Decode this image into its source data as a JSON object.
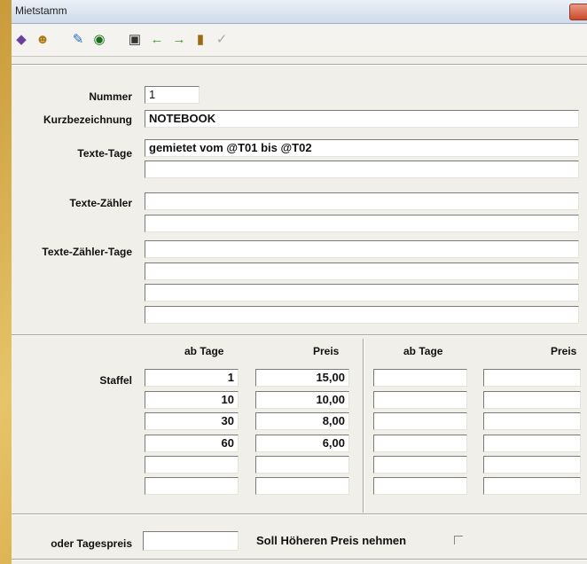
{
  "window": {
    "title": "Mietstamm"
  },
  "toolbar": {
    "icons": [
      "book-icon",
      "users-icon",
      "edit-image-icon",
      "record-icon",
      "binoculars-icon",
      "arrow-left-icon",
      "arrow-right-icon",
      "exit-door-icon",
      "checkmark-icon"
    ]
  },
  "form": {
    "nummer_label": "Nummer",
    "nummer_value": "1",
    "kurz_label": "Kurzbezeichnung",
    "kurz_value": "NOTEBOOK",
    "texte_tage_label": "Texte-Tage",
    "texte_tage_values": [
      "gemietet vom @T01 bis @T02",
      ""
    ],
    "texte_zaehler_label": "Texte-Zähler",
    "texte_zaehler_values": [
      "",
      ""
    ],
    "texte_zaehler_tage_label": "Texte-Zähler-Tage",
    "texte_zaehler_tage_values": [
      "",
      "",
      "",
      ""
    ]
  },
  "staffel": {
    "label": "Staffel",
    "col_ab_tage": "ab Tage",
    "col_preis": "Preis",
    "left_rows": [
      {
        "ab_tage": "1",
        "preis": "15,00"
      },
      {
        "ab_tage": "10",
        "preis": "10,00"
      },
      {
        "ab_tage": "30",
        "preis": "8,00"
      },
      {
        "ab_tage": "60",
        "preis": "6,00"
      },
      {
        "ab_tage": "",
        "preis": ""
      },
      {
        "ab_tage": "",
        "preis": ""
      }
    ],
    "right_rows": [
      {
        "ab_tage": "",
        "preis": ""
      },
      {
        "ab_tage": "",
        "preis": ""
      },
      {
        "ab_tage": "",
        "preis": ""
      },
      {
        "ab_tage": "",
        "preis": ""
      },
      {
        "ab_tage": "",
        "preis": ""
      },
      {
        "ab_tage": "",
        "preis": ""
      }
    ]
  },
  "footer": {
    "tagespreis_label": "oder Tagespreis",
    "tagespreis_value": "",
    "hoeher_label": "Soll Höheren Preis nehmen",
    "hoeher_checked": false
  }
}
